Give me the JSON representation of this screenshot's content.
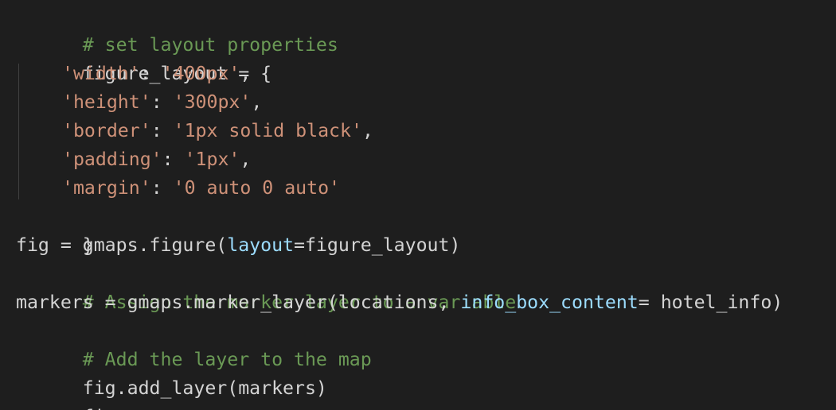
{
  "editor": {
    "lines": {
      "l01": {
        "comment": "# set layout properties"
      },
      "l02": {
        "text": "figure_layout = {"
      },
      "l03": {
        "key": "'width'",
        "sep": ": ",
        "value": "'400px'",
        "end": ","
      },
      "l04": {
        "key": "'height'",
        "sep": ": ",
        "value": "'300px'",
        "end": ","
      },
      "l05": {
        "key": "'border'",
        "sep": ": ",
        "value": "'1px solid black'",
        "end": ","
      },
      "l06": {
        "key": "'padding'",
        "sep": ": ",
        "value": "'1px'",
        "end": ","
      },
      "l07": {
        "key": "'margin'",
        "sep": ": ",
        "value": "'0 auto 0 auto'"
      },
      "l08": {
        "text": "}"
      },
      "l09": {
        "pre": "fig = gmaps.figure(",
        "param": "layout",
        "post": "=figure_layout)"
      },
      "l10": {
        "comment": "# Assign the marker layer to a variable"
      },
      "l11": {
        "pre": "markers = gmaps.marker_layer(locations, ",
        "param": "info_box_content",
        "post": "= hotel_info)"
      },
      "l12": {
        "comment": "# Add the layer to the map"
      },
      "l13": {
        "text": "fig.add_layer(markers)"
      },
      "l14": {
        "text": "fig"
      }
    },
    "colors": {
      "background": "#1e1e1e",
      "default_text": "#d4d4d4",
      "comment": "#6a9955",
      "string": "#ce9178",
      "parameter": "#9cdcfe"
    }
  }
}
